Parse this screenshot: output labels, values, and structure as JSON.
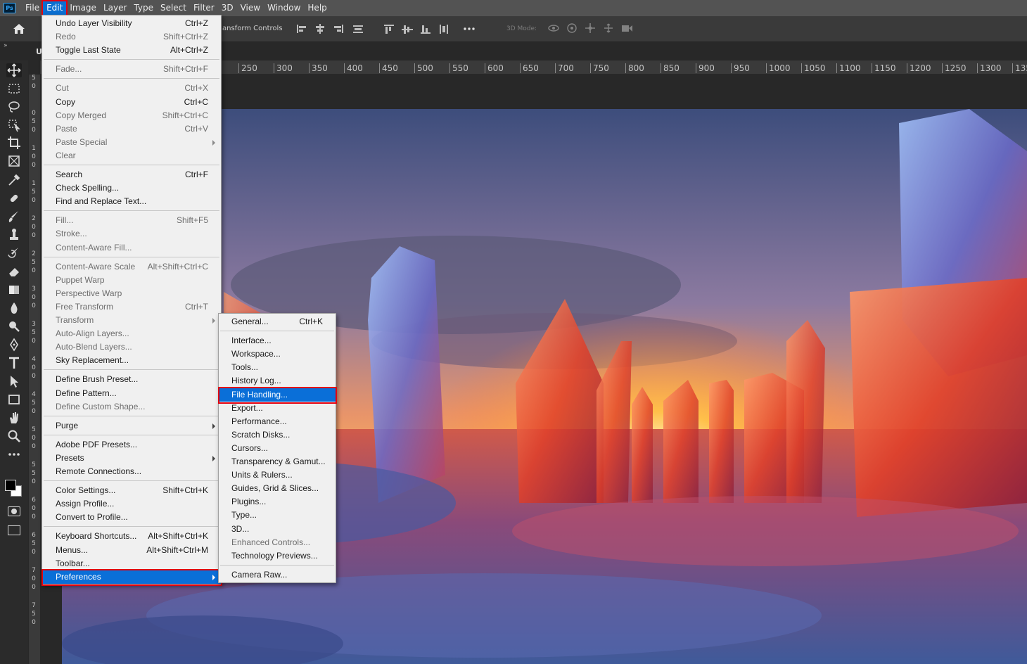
{
  "app": {
    "logo": "Ps"
  },
  "menubar": {
    "items": [
      "File",
      "Edit",
      "Image",
      "Layer",
      "Type",
      "Select",
      "Filter",
      "3D",
      "View",
      "Window",
      "Help"
    ],
    "active": "Edit"
  },
  "options_bar": {
    "transform_controls_label": "ansform Controls",
    "mode_3d_label": "3D Mode:",
    "icons": [
      "align-left-icon",
      "align-center-icon",
      "align-right-icon",
      "distribute-icon",
      "align-top-icon",
      "align-middle-icon",
      "align-bottom-icon",
      "distribute-vertical-icon",
      "more-icon"
    ],
    "icons_3d": [
      "orbit-3d-icon",
      "roll-3d-icon",
      "pan-3d-icon",
      "slide-3d-icon",
      "scale-3d-icon"
    ]
  },
  "document_tab": {
    "label": "U"
  },
  "ruler": {
    "horizontal": [
      "250",
      "300",
      "350",
      "400",
      "450",
      "500",
      "550",
      "600",
      "650",
      "700",
      "750",
      "800",
      "850",
      "900",
      "950",
      "1000",
      "1050",
      "1100",
      "1150",
      "1200",
      "1250",
      "1300",
      "135"
    ],
    "vertical": [
      "5",
      "0",
      "0",
      "5",
      "0",
      "1",
      "0",
      "0",
      "1",
      "5",
      "0",
      "2",
      "0",
      "0",
      "2",
      "5",
      "0",
      "3",
      "0",
      "0",
      "3",
      "5",
      "0",
      "4",
      "0",
      "0",
      "4",
      "5",
      "0",
      "5",
      "0",
      "0",
      "5",
      "5",
      "0",
      "6",
      "0",
      "0",
      "6",
      "5",
      "0",
      "7",
      "0",
      "0",
      "7",
      "5",
      "0"
    ]
  },
  "tools": [
    "move-tool-icon",
    "marquee-tool-icon",
    "lasso-tool-icon",
    "object-select-tool-icon",
    "crop-tool-icon",
    "frame-tool-icon",
    "eyedropper-tool-icon",
    "healing-brush-icon",
    "brush-tool-icon",
    "clone-stamp-icon",
    "history-brush-icon",
    "eraser-tool-icon",
    "gradient-tool-icon",
    "blur-tool-icon",
    "dodge-tool-icon",
    "pen-tool-icon",
    "type-tool-icon",
    "path-select-tool-icon",
    "rectangle-tool-icon",
    "hand-tool-icon",
    "zoom-tool-icon",
    "more-tools-icon"
  ],
  "colors": {
    "foreground": "#000000",
    "background": "#ffffff",
    "highlight": "#0a6fd8",
    "annotation": "#e3000f"
  },
  "edit_menu": {
    "groups": [
      [
        {
          "label": "Undo Layer Visibility",
          "shortcut": "Ctrl+Z",
          "enabled": true
        },
        {
          "label": "Redo",
          "shortcut": "Shift+Ctrl+Z",
          "enabled": false
        },
        {
          "label": "Toggle Last State",
          "shortcut": "Alt+Ctrl+Z",
          "enabled": true
        }
      ],
      [
        {
          "label": "Fade...",
          "shortcut": "Shift+Ctrl+F",
          "enabled": false
        }
      ],
      [
        {
          "label": "Cut",
          "shortcut": "Ctrl+X",
          "enabled": false
        },
        {
          "label": "Copy",
          "shortcut": "Ctrl+C",
          "enabled": true
        },
        {
          "label": "Copy Merged",
          "shortcut": "Shift+Ctrl+C",
          "enabled": false
        },
        {
          "label": "Paste",
          "shortcut": "Ctrl+V",
          "enabled": false
        },
        {
          "label": "Paste Special",
          "shortcut": "",
          "enabled": false,
          "submenu": true
        },
        {
          "label": "Clear",
          "shortcut": "",
          "enabled": false
        }
      ],
      [
        {
          "label": "Search",
          "shortcut": "Ctrl+F",
          "enabled": true
        },
        {
          "label": "Check Spelling...",
          "shortcut": "",
          "enabled": true
        },
        {
          "label": "Find and Replace Text...",
          "shortcut": "",
          "enabled": true
        }
      ],
      [
        {
          "label": "Fill...",
          "shortcut": "Shift+F5",
          "enabled": false
        },
        {
          "label": "Stroke...",
          "shortcut": "",
          "enabled": false
        },
        {
          "label": "Content-Aware Fill...",
          "shortcut": "",
          "enabled": false
        }
      ],
      [
        {
          "label": "Content-Aware Scale",
          "shortcut": "Alt+Shift+Ctrl+C",
          "enabled": false
        },
        {
          "label": "Puppet Warp",
          "shortcut": "",
          "enabled": false
        },
        {
          "label": "Perspective Warp",
          "shortcut": "",
          "enabled": false
        },
        {
          "label": "Free Transform",
          "shortcut": "Ctrl+T",
          "enabled": false
        },
        {
          "label": "Transform",
          "shortcut": "",
          "enabled": false,
          "submenu": true
        },
        {
          "label": "Auto-Align Layers...",
          "shortcut": "",
          "enabled": false
        },
        {
          "label": "Auto-Blend Layers...",
          "shortcut": "",
          "enabled": false
        },
        {
          "label": "Sky Replacement...",
          "shortcut": "",
          "enabled": true
        }
      ],
      [
        {
          "label": "Define Brush Preset...",
          "shortcut": "",
          "enabled": true
        },
        {
          "label": "Define Pattern...",
          "shortcut": "",
          "enabled": true
        },
        {
          "label": "Define Custom Shape...",
          "shortcut": "",
          "enabled": false
        }
      ],
      [
        {
          "label": "Purge",
          "shortcut": "",
          "enabled": true,
          "submenu": true
        }
      ],
      [
        {
          "label": "Adobe PDF Presets...",
          "shortcut": "",
          "enabled": true
        },
        {
          "label": "Presets",
          "shortcut": "",
          "enabled": true,
          "submenu": true
        },
        {
          "label": "Remote Connections...",
          "shortcut": "",
          "enabled": true
        }
      ],
      [
        {
          "label": "Color Settings...",
          "shortcut": "Shift+Ctrl+K",
          "enabled": true
        },
        {
          "label": "Assign Profile...",
          "shortcut": "",
          "enabled": true
        },
        {
          "label": "Convert to Profile...",
          "shortcut": "",
          "enabled": true
        }
      ],
      [
        {
          "label": "Keyboard Shortcuts...",
          "shortcut": "Alt+Shift+Ctrl+K",
          "enabled": true
        },
        {
          "label": "Menus...",
          "shortcut": "Alt+Shift+Ctrl+M",
          "enabled": true
        },
        {
          "label": "Toolbar...",
          "shortcut": "",
          "enabled": true
        },
        {
          "label": "Preferences",
          "shortcut": "",
          "enabled": true,
          "submenu": true,
          "highlighted": true
        }
      ]
    ]
  },
  "preferences_menu": {
    "groups": [
      [
        {
          "label": "General...",
          "shortcut": "Ctrl+K",
          "enabled": true
        }
      ],
      [
        {
          "label": "Interface...",
          "shortcut": "",
          "enabled": true
        },
        {
          "label": "Workspace...",
          "shortcut": "",
          "enabled": true
        },
        {
          "label": "Tools...",
          "shortcut": "",
          "enabled": true
        },
        {
          "label": "History Log...",
          "shortcut": "",
          "enabled": true
        },
        {
          "label": "File Handling...",
          "shortcut": "",
          "enabled": true,
          "highlighted": true
        },
        {
          "label": "Export...",
          "shortcut": "",
          "enabled": true
        },
        {
          "label": "Performance...",
          "shortcut": "",
          "enabled": true
        },
        {
          "label": "Scratch Disks...",
          "shortcut": "",
          "enabled": true
        },
        {
          "label": "Cursors...",
          "shortcut": "",
          "enabled": true
        },
        {
          "label": "Transparency & Gamut...",
          "shortcut": "",
          "enabled": true
        },
        {
          "label": "Units & Rulers...",
          "shortcut": "",
          "enabled": true
        },
        {
          "label": "Guides, Grid & Slices...",
          "shortcut": "",
          "enabled": true
        },
        {
          "label": "Plugins...",
          "shortcut": "",
          "enabled": true
        },
        {
          "label": "Type...",
          "shortcut": "",
          "enabled": true
        },
        {
          "label": "3D...",
          "shortcut": "",
          "enabled": true
        },
        {
          "label": "Enhanced Controls...",
          "shortcut": "",
          "enabled": false
        },
        {
          "label": "Technology Previews...",
          "shortcut": "",
          "enabled": true
        }
      ],
      [
        {
          "label": "Camera Raw...",
          "shortcut": "",
          "enabled": true
        }
      ]
    ]
  }
}
